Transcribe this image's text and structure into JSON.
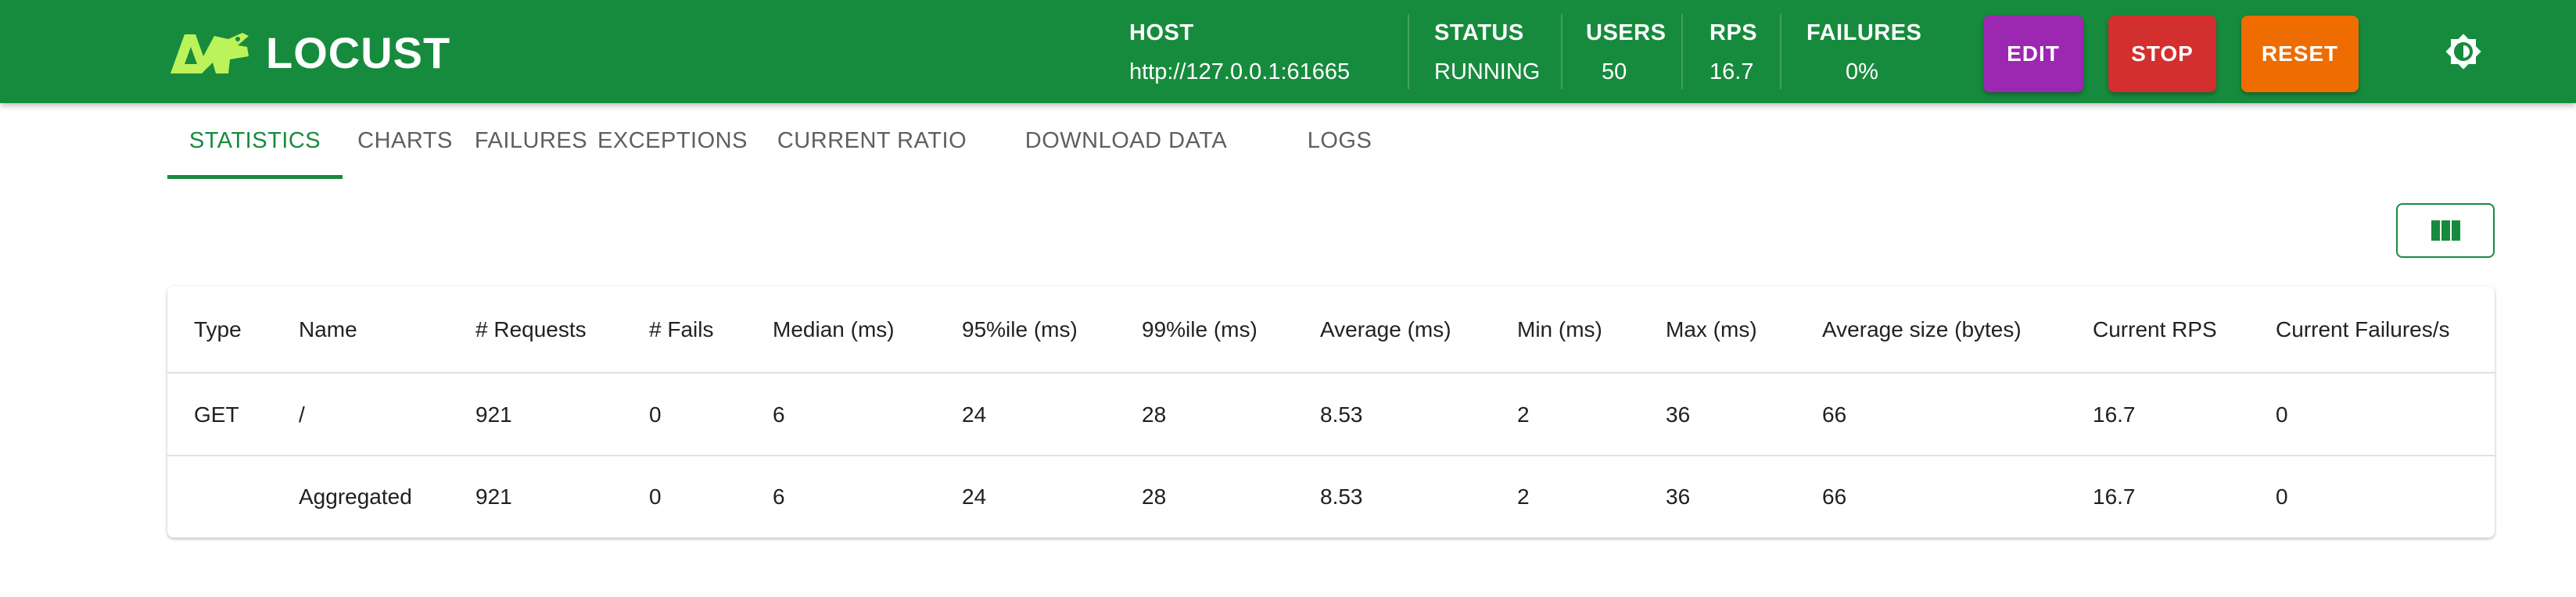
{
  "header": {
    "logo_text": "LOCUST",
    "stats": [
      {
        "label": "HOST",
        "value": "http://127.0.0.1:61665"
      },
      {
        "label": "STATUS",
        "value": "RUNNING"
      },
      {
        "label": "USERS",
        "value": "50"
      },
      {
        "label": "RPS",
        "value": "16.7"
      },
      {
        "label": "FAILURES",
        "value": "0%"
      }
    ],
    "buttons": {
      "edit": "EDIT",
      "stop": "STOP",
      "reset": "RESET"
    },
    "colors": {
      "appbar": "#178b3d",
      "edit": "#9c27b0",
      "stop": "#d32f2f",
      "reset": "#ef6c00",
      "logo": "#bdf35a"
    }
  },
  "tabs": [
    "STATISTICS",
    "CHARTS",
    "FAILURES",
    "EXCEPTIONS",
    "CURRENT RATIO",
    "DOWNLOAD DATA",
    "LOGS"
  ],
  "active_tab": "STATISTICS",
  "icons": {
    "logo": "locust-logo-icon",
    "theme": "brightness-icon",
    "columns": "view-columns-icon"
  },
  "table": {
    "columns": [
      "Type",
      "Name",
      "# Requests",
      "# Fails",
      "Median (ms)",
      "95%ile (ms)",
      "99%ile (ms)",
      "Average (ms)",
      "Min (ms)",
      "Max (ms)",
      "Average size (bytes)",
      "Current RPS",
      "Current Failures/s"
    ],
    "rows": [
      [
        "GET",
        "/",
        "921",
        "0",
        "6",
        "24",
        "28",
        "8.53",
        "2",
        "36",
        "66",
        "16.7",
        "0"
      ],
      [
        "",
        "Aggregated",
        "921",
        "0",
        "6",
        "24",
        "28",
        "8.53",
        "2",
        "36",
        "66",
        "16.7",
        "0"
      ]
    ]
  }
}
